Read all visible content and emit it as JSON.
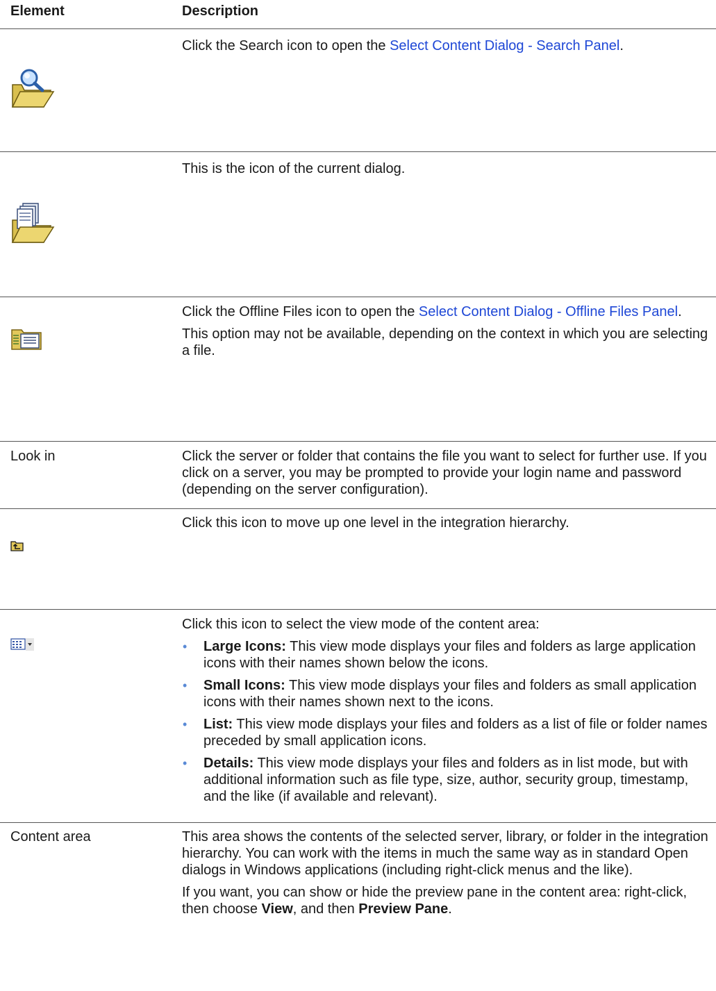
{
  "table": {
    "headers": {
      "element": "Element",
      "description": "Description"
    },
    "rows": [
      {
        "element_icon": "search-folder-icon",
        "text_before": "Click the Search icon to open the ",
        "link": "Select Content Dialog - Search Panel",
        "text_after": "."
      },
      {
        "element_icon": "current-dialog-folder-icon",
        "text": "This is the icon of the current dialog."
      },
      {
        "element_icon": "offline-files-icon",
        "text_before": "Click the Offline Files icon to open the ",
        "link": "Select Content Dialog - Offline Files Panel",
        "text_after": ".",
        "note": "This option may not be available, depending on the context in which you are selecting a file."
      },
      {
        "element": "Look in",
        "text": "Click the server or folder that contains the file you want to select for further use. If you click on a server, you may be prompted to provide your login name and password (depending on the server configuration)."
      },
      {
        "element_icon": "up-one-level-icon",
        "text": "Click this icon to move up one level in the integration hierarchy."
      },
      {
        "element_icon": "view-mode-icon",
        "text": "Click this icon to select the view mode of the content area:",
        "items": [
          {
            "term": "Large Icons:",
            "text": " This view mode displays your files and folders as large application icons with their names shown below the icons."
          },
          {
            "term": "Small Icons:",
            "text": " This view mode displays your files and folders as small application icons with their names shown next to the icons."
          },
          {
            "term": "List:",
            "text": " This view mode displays your files and folders as a list of file or folder names preceded by small application icons."
          },
          {
            "term": "Details:",
            "text": " This view mode displays your files and folders as in list mode, but with additional information such as file type, size, author, security group, timestamp, and the like (if available and relevant)."
          }
        ]
      },
      {
        "element": "Content area",
        "text": "This area shows the contents of the selected server, library, or folder in the integration hierarchy. You can work with the items in much the same way as in standard Open dialogs in Windows applications (including right-click menus and the like).",
        "note_before": "If you want, you can show or hide the preview pane in the content area: right-click, then choose ",
        "note_b1": "View",
        "note_mid": ", and then ",
        "note_b2": "Preview Pane",
        "note_after": "."
      }
    ]
  },
  "bullet_char": "•",
  "colors": {
    "link": "#1e47d6",
    "bullet": "#5a8ad6",
    "folder": "#e2c85a"
  }
}
